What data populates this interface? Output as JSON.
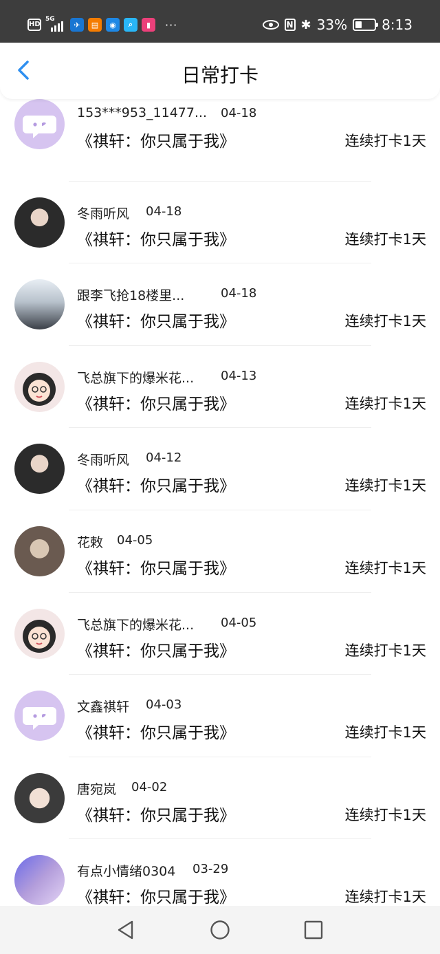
{
  "status_bar": {
    "hd": "HD",
    "network": "5G",
    "battery": "33%",
    "time": "8:13",
    "dots": "···"
  },
  "header": {
    "title": "日常打卡"
  },
  "rows": [
    {
      "name": "153***953_11477...",
      "date": "04-18",
      "book": "《祺轩：你只属于我》",
      "streak": "连续打卡1天",
      "avatar": "default"
    },
    {
      "name": "冬雨听风",
      "date": "04-18",
      "book": "《祺轩：你只属于我》",
      "streak": "连续打卡1天",
      "avatar": "dark1"
    },
    {
      "name": "跟李飞抢18楼里...",
      "date": "04-18",
      "book": "《祺轩：你只属于我》",
      "streak": "连续打卡1天",
      "avatar": "group"
    },
    {
      "name": "飞总旗下的爆米花...",
      "date": "04-13",
      "book": "《祺轩：你只属于我》",
      "streak": "连续打卡1天",
      "avatar": "cartoon"
    },
    {
      "name": "冬雨听风",
      "date": "04-12",
      "book": "《祺轩：你只属于我》",
      "streak": "连续打卡1天",
      "avatar": "dark1"
    },
    {
      "name": "花敕",
      "date": "04-05",
      "book": "《祺轩：你只属于我》",
      "streak": "连续打卡1天",
      "avatar": "child"
    },
    {
      "name": "飞总旗下的爆米花...",
      "date": "04-05",
      "book": "《祺轩：你只属于我》",
      "streak": "连续打卡1天",
      "avatar": "cartoon"
    },
    {
      "name": "文鑫祺轩",
      "date": "04-03",
      "book": "《祺轩：你只属于我》",
      "streak": "连续打卡1天",
      "avatar": "default"
    },
    {
      "name": "唐宛岚",
      "date": "04-02",
      "book": "《祺轩：你只属于我》",
      "streak": "连续打卡1天",
      "avatar": "boy"
    },
    {
      "name": "有点小情绪0304",
      "date": "03-29",
      "book": "《祺轩：你只属于我》",
      "streak": "连续打卡1天",
      "avatar": "purple"
    }
  ],
  "colors": {
    "status_bar_bg": "#3d3d3d",
    "accent_blue": "#2f8ff0",
    "default_avatar": "#d6c4f0"
  }
}
